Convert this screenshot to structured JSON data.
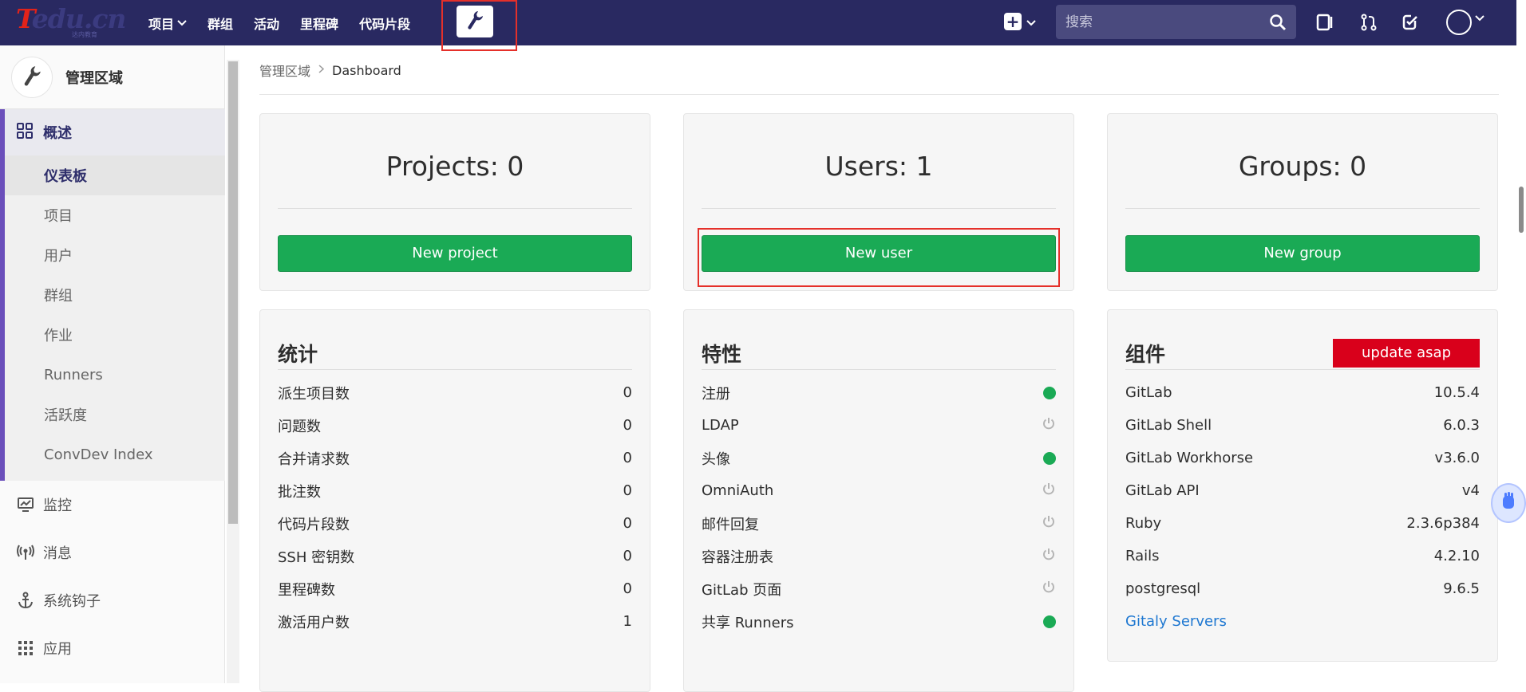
{
  "logo": {
    "brand_t": "T",
    "brand_rest": "edu.cn",
    "sub": "达内教育"
  },
  "nav": {
    "items": [
      {
        "label": "项目",
        "has_dropdown": true
      },
      {
        "label": "群组"
      },
      {
        "label": "活动"
      },
      {
        "label": "里程碑"
      },
      {
        "label": "代码片段"
      }
    ],
    "admin_icon": "wrench-icon"
  },
  "search": {
    "placeholder": "搜索"
  },
  "sidebar": {
    "title": "管理区域",
    "section": {
      "label": "概述",
      "icon": "grid-icon"
    },
    "sub_items": [
      {
        "label": "仪表板",
        "active": true
      },
      {
        "label": "项目"
      },
      {
        "label": "用户"
      },
      {
        "label": "群组"
      },
      {
        "label": "作业"
      },
      {
        "label": "Runners"
      },
      {
        "label": "活跃度"
      },
      {
        "label": "ConvDev Index"
      }
    ],
    "main_items": [
      {
        "label": "监控",
        "icon": "monitor-icon"
      },
      {
        "label": "消息",
        "icon": "broadcast-icon"
      },
      {
        "label": "系统钩子",
        "icon": "anchor-icon"
      },
      {
        "label": "应用",
        "icon": "apps-grid-icon"
      }
    ]
  },
  "breadcrumb": {
    "root": "管理区域",
    "current": "Dashboard"
  },
  "cards": {
    "projects": {
      "title": "Projects: 0",
      "button": "New project"
    },
    "users": {
      "title": "Users: 1",
      "button": "New user"
    },
    "groups": {
      "title": "Groups: 0",
      "button": "New group"
    }
  },
  "stats": {
    "title": "统计",
    "rows": [
      {
        "label": "派生项目数",
        "value": "0"
      },
      {
        "label": "问题数",
        "value": "0"
      },
      {
        "label": "合并请求数",
        "value": "0"
      },
      {
        "label": "批注数",
        "value": "0"
      },
      {
        "label": "代码片段数",
        "value": "0"
      },
      {
        "label": "SSH 密钥数",
        "value": "0"
      },
      {
        "label": "里程碑数",
        "value": "0"
      },
      {
        "label": "激活用户数",
        "value": "1"
      }
    ]
  },
  "features": {
    "title": "特性",
    "rows": [
      {
        "label": "注册",
        "enabled": true
      },
      {
        "label": "LDAP",
        "enabled": false
      },
      {
        "label": "头像",
        "enabled": true
      },
      {
        "label": "OmniAuth",
        "enabled": false
      },
      {
        "label": "邮件回复",
        "enabled": false
      },
      {
        "label": "容器注册表",
        "enabled": false
      },
      {
        "label": "GitLab 页面",
        "enabled": false
      },
      {
        "label": "共享 Runners",
        "enabled": true
      }
    ]
  },
  "components": {
    "title": "组件",
    "badge": "update asap",
    "rows": [
      {
        "label": "GitLab",
        "value": "10.5.4"
      },
      {
        "label": "GitLab Shell",
        "value": "6.0.3"
      },
      {
        "label": "GitLab Workhorse",
        "value": "v3.6.0"
      },
      {
        "label": "GitLab API",
        "value": "v4"
      },
      {
        "label": "Ruby",
        "value": "2.3.6p384"
      },
      {
        "label": "Rails",
        "value": "4.2.10"
      },
      {
        "label": "postgresql",
        "value": "9.6.5"
      }
    ],
    "link": "Gitaly Servers"
  },
  "colors": {
    "navbar": "#292961",
    "success": "#1aaa55",
    "danger": "#d9001b",
    "highlight": "#e5302a",
    "link": "#1f78d1"
  }
}
